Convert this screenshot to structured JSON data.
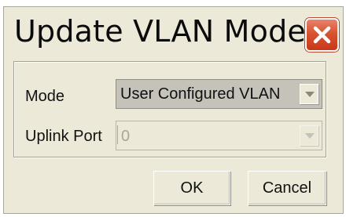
{
  "dialog": {
    "title": "Update VLAN Mode",
    "close_icon": "close-x-icon",
    "accent_close_color": "#d9532f"
  },
  "form": {
    "mode": {
      "label": "Mode",
      "selected": "User Configured VLAN"
    },
    "uplink_port": {
      "label": "Uplink Port",
      "selected": "0",
      "enabled": false
    }
  },
  "buttons": {
    "ok_label": "OK",
    "cancel_label": "Cancel"
  }
}
